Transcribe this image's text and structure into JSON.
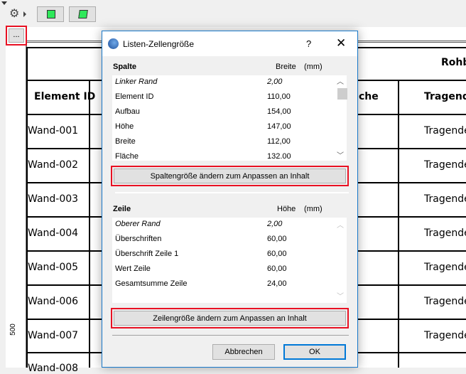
{
  "toolbar": {
    "more_label": "..."
  },
  "ruler": {
    "label_500": "500"
  },
  "table": {
    "header_group": "Rohba",
    "headers": [
      "Element ID",
      "che",
      "Tragende"
    ],
    "rows": [
      {
        "id": "Wand-001",
        "v": "Tragende"
      },
      {
        "id": "Wand-002",
        "v": "Tragende"
      },
      {
        "id": "Wand-003",
        "v": "Tragende"
      },
      {
        "id": "Wand-004",
        "v": "Tragende"
      },
      {
        "id": "Wand-005",
        "v": "Tragende"
      },
      {
        "id": "Wand-006",
        "v": "Tragende"
      },
      {
        "id": "Wand-007",
        "v": "Tragende"
      }
    ]
  },
  "dialog": {
    "title": "Listen-Zellengröße",
    "help": "?",
    "column_section": {
      "label": "Spalte",
      "value_header": "Breite",
      "unit": "(mm)",
      "items": [
        {
          "name": "Linker Rand",
          "value": "2,00",
          "italic": true
        },
        {
          "name": "Element ID",
          "value": "110,00"
        },
        {
          "name": "Aufbau",
          "value": "154,00"
        },
        {
          "name": "Höhe",
          "value": "147,00"
        },
        {
          "name": "Breite",
          "value": "112,00"
        },
        {
          "name": "Fläche",
          "value": "132.00"
        }
      ],
      "fit_button": "Spaltengröße ändern zum Anpassen an Inhalt"
    },
    "row_section": {
      "label": "Zeile",
      "value_header": "Höhe",
      "unit": "(mm)",
      "items": [
        {
          "name": "Oberer Rand",
          "value": "2,00",
          "italic": true
        },
        {
          "name": "Überschriften",
          "value": "60,00"
        },
        {
          "name": "Überschrift Zeile 1",
          "value": "60,00"
        },
        {
          "name": "Wert Zeile",
          "value": "60,00"
        },
        {
          "name": "Gesamtsumme Zeile",
          "value": "24,00"
        }
      ],
      "fit_button": "Zeilengröße ändern zum Anpassen an Inhalt"
    },
    "cancel": "Abbrechen",
    "ok": "OK"
  }
}
